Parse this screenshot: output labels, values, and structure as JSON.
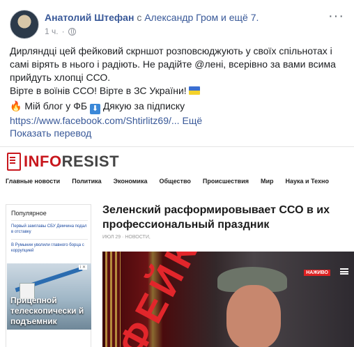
{
  "post": {
    "author": "Анатолий Штефан",
    "with_prefix": "с",
    "with_names": "Александр Гром и ещё 7.",
    "time": "1 ч.",
    "time_separator": "·",
    "more_icon": "···",
    "text_line1": "Дирляндці цей фейковий скрншот розповсюджують у своїх спільнотах і самі вірять в нього і радіють. Не радійте @лені, всерівно за вами всима прийдуть хлопці ССО.",
    "text_line2": "Вірте в воїнів ССО! Вірте в ЗС України!",
    "blog_line": "Мій блог у ФБ",
    "thanks_line": "Дякую за підписку",
    "link": "https://www.facebook.com/Shtirlitz69/...",
    "more_link": "Ещё",
    "translate": "Показать перевод",
    "icons": {
      "fire": "fire-icon",
      "arrow": "arrow-down-icon",
      "flag": "ukraine-flag-icon",
      "globe": "globe-icon"
    }
  },
  "article": {
    "logo_part1": "INFO",
    "logo_part2": "RESIST",
    "nav": [
      "Главные новости",
      "Политика",
      "Экономика",
      "Общество",
      "Происшествия",
      "Мир",
      "Наука и Техно"
    ],
    "sidebar": {
      "title": "Популярное",
      "items": [
        "Первый замглавы СБУ Демчина подал в отставку",
        "В Румынии уволили главного борца с коррупцией"
      ],
      "ad_text": "Прицепной телескопически й подъемник",
      "ad_badge": "i ✕"
    },
    "headline": "Зеленский расформировывает ССО в их профессиональный праздник",
    "meta": "ИЮЛ 29 · НОВОСТИ,",
    "photo": {
      "fake_stamp": "ФЕЙК",
      "live_badge": "НАЖИВО"
    }
  },
  "colors": {
    "facebook_link": "#385898",
    "inforesist_red": "#c8171d",
    "fake_red": "#e2262b"
  }
}
